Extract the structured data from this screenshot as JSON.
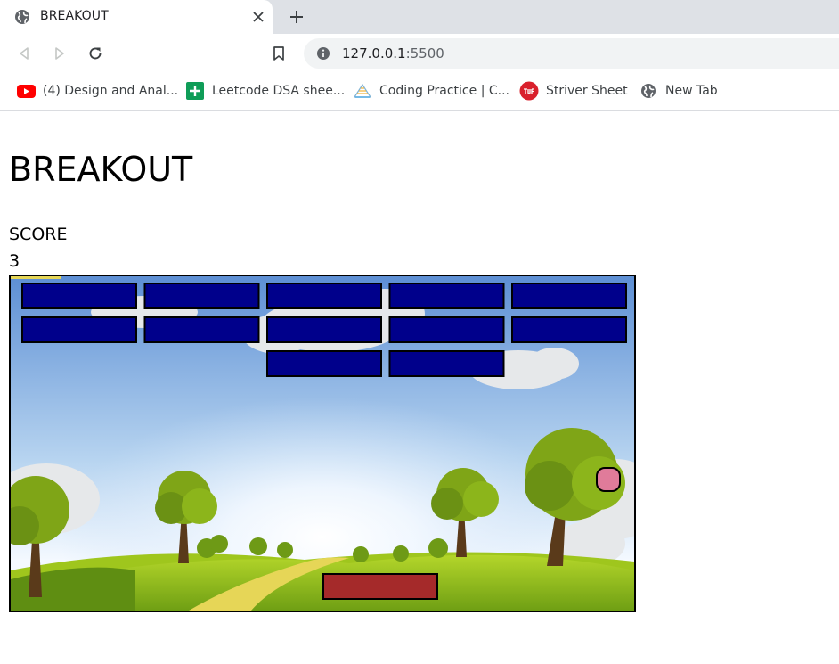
{
  "browser": {
    "tab": {
      "title": "BREAKOUT",
      "icon": "globe-icon"
    },
    "new_tab_symbol": "+",
    "address": {
      "host": "127.0.0.1",
      "port": ":5500",
      "icon": "info-icon"
    },
    "bookmarks": [
      {
        "label": "(4) Design and Anal...",
        "icon": "youtube-icon"
      },
      {
        "label": "Leetcode DSA shee...",
        "icon": "google-sheets-icon"
      },
      {
        "label": "Coding Practice | C...",
        "icon": "coding-practice-icon"
      },
      {
        "label": "Striver Sheet",
        "icon": "tuf-icon"
      },
      {
        "label": "New Tab",
        "icon": "globe-icon"
      }
    ]
  },
  "page": {
    "title": "BREAKOUT",
    "score_label": "SCORE",
    "score": "3"
  },
  "game": {
    "brick_color": "#00008b",
    "paddle_color": "#a52a2a",
    "ball_color": "#e07b9a",
    "bricks": {
      "rows": 3,
      "columns": 5,
      "remaining": [
        [
          true,
          true,
          true,
          true,
          true
        ],
        [
          true,
          true,
          true,
          true,
          true
        ],
        [
          false,
          false,
          true,
          true,
          false
        ]
      ]
    }
  }
}
